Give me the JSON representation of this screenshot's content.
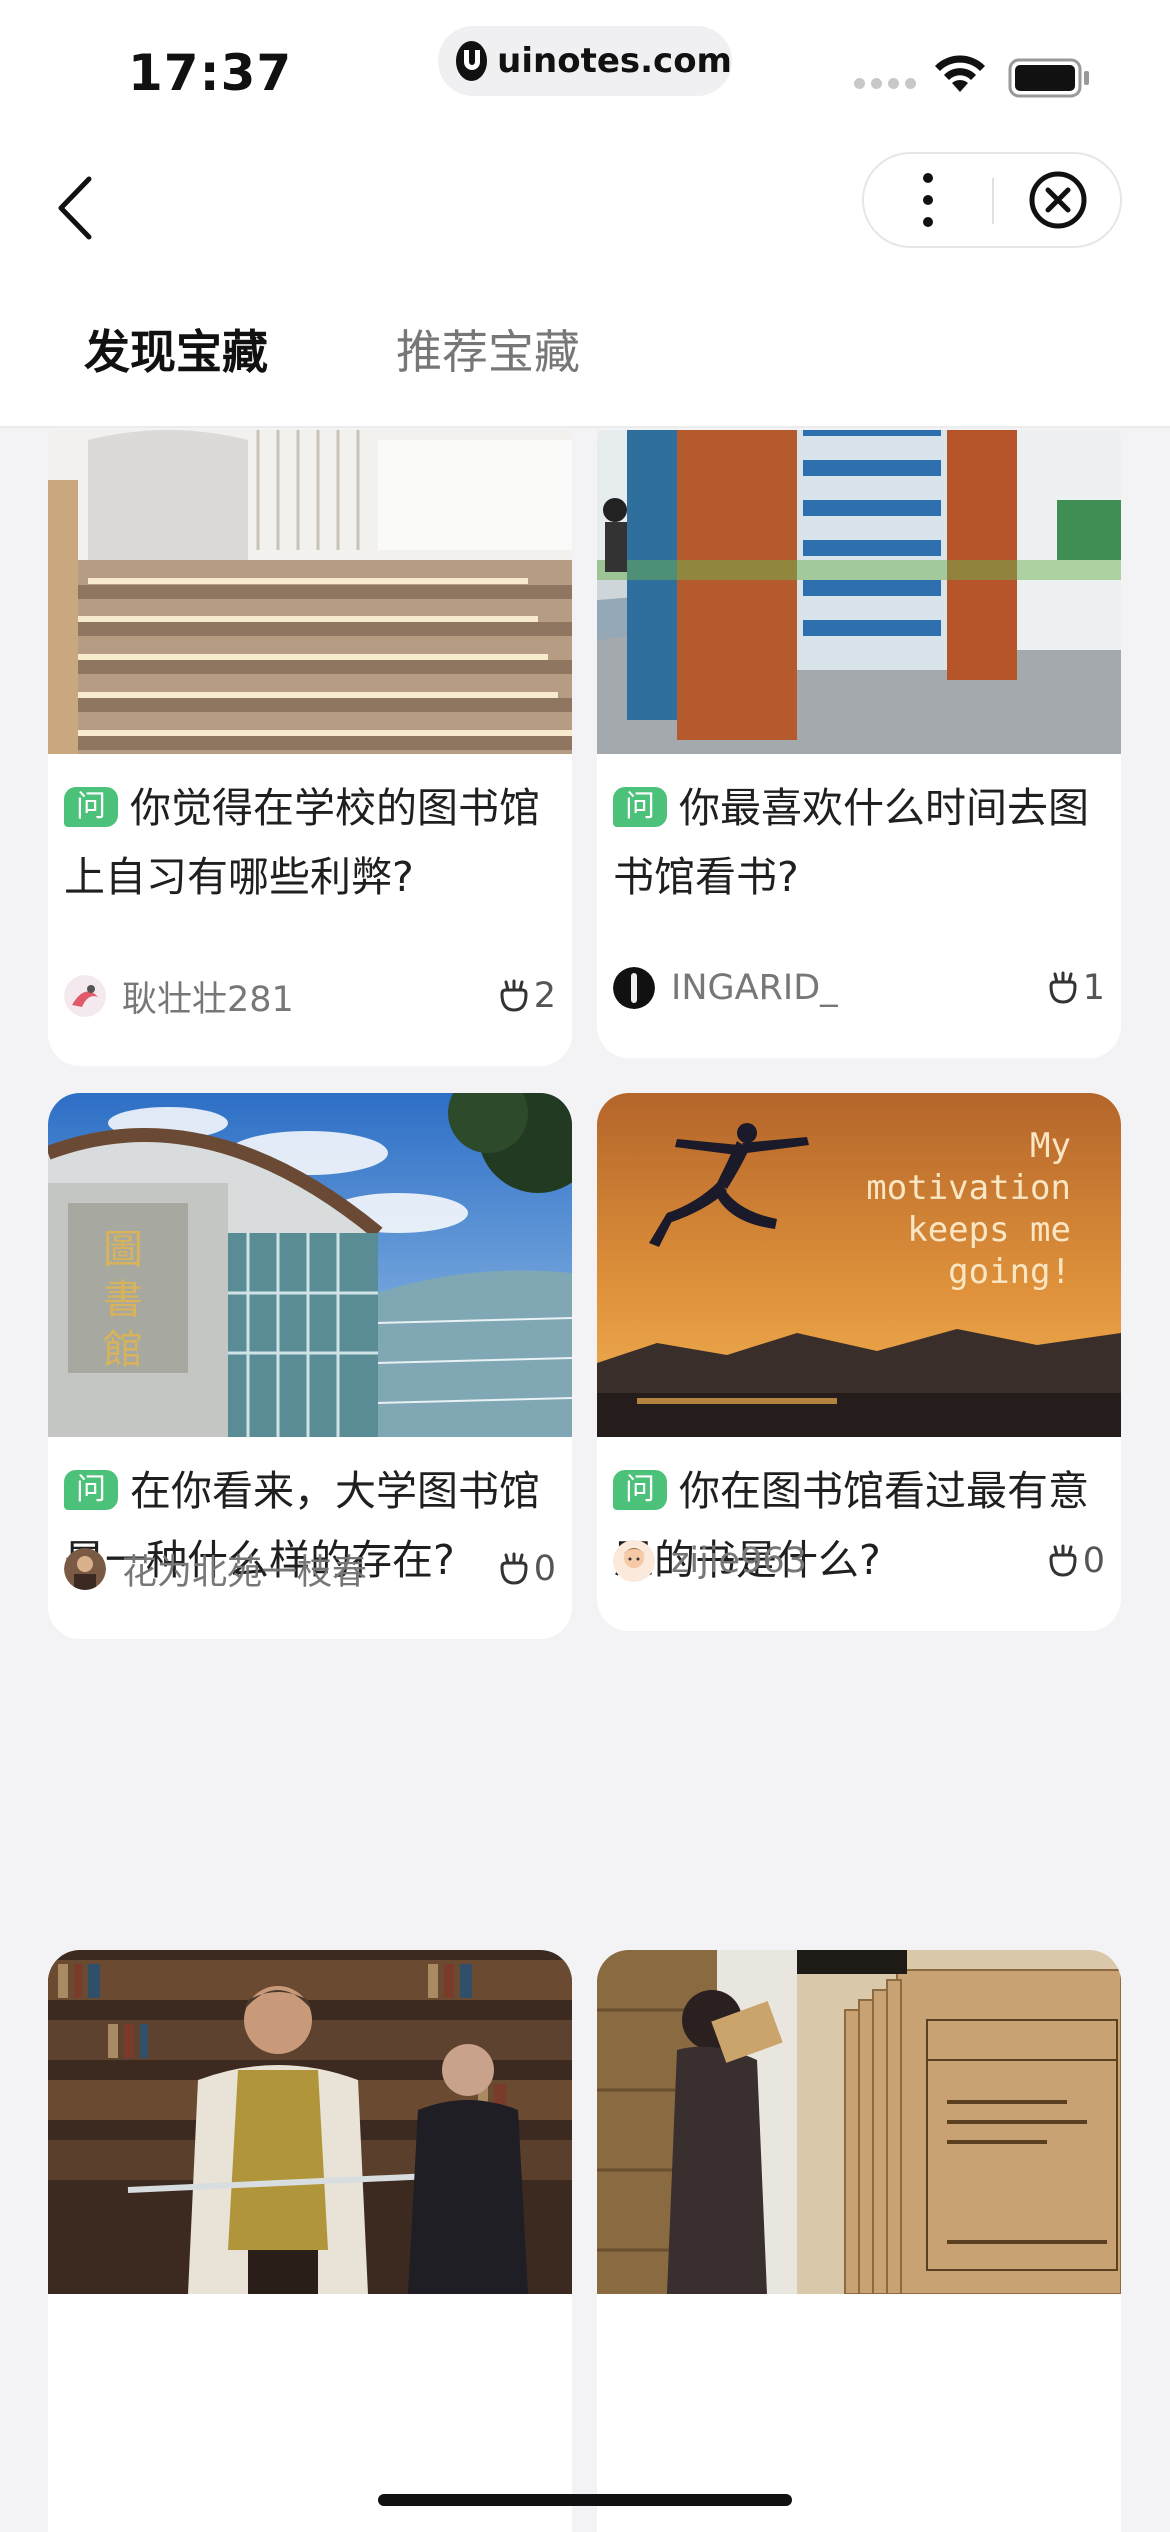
{
  "status_bar": {
    "time": "17:37",
    "url": "uinotes.com"
  },
  "tabs": [
    {
      "label": "发现宝藏",
      "active": true
    },
    {
      "label": "推荐宝藏",
      "active": false
    }
  ],
  "badge_label": "问",
  "cards": [
    {
      "title": "你觉得在学校的图书馆上自习有哪些利弊?",
      "author": "耿壮壮281",
      "likes": "2",
      "image": "library-stairs"
    },
    {
      "title": "你最喜欢什么时间去图书馆看书?",
      "author": "INGARID_",
      "likes": "1",
      "image": "library-bookshelves"
    },
    {
      "title": "在你看来，大学图书馆是一种什么样的存在?",
      "author": "花为北苑一枝春",
      "likes": "0",
      "image": "library-building"
    },
    {
      "title": "你在图书馆看过最有意思的书是什么?",
      "author": "zijie963",
      "likes": "0",
      "image": "motivation-runner"
    },
    {
      "title": "",
      "author": "",
      "likes": "",
      "image": "man-in-library"
    },
    {
      "title": "",
      "author": "",
      "likes": "",
      "image": "archive-files"
    }
  ],
  "image_captions": {
    "motivation": [
      "My",
      "motivation",
      "keeps me",
      "going!"
    ]
  },
  "colors": {
    "accent": "#3bbf6a",
    "badge": "#4cc17a",
    "background": "#f3f3f5"
  },
  "icons": [
    "back-arrow-icon",
    "more-icon",
    "close-circle-icon",
    "like-icon",
    "wifi-icon",
    "battery-icon"
  ]
}
